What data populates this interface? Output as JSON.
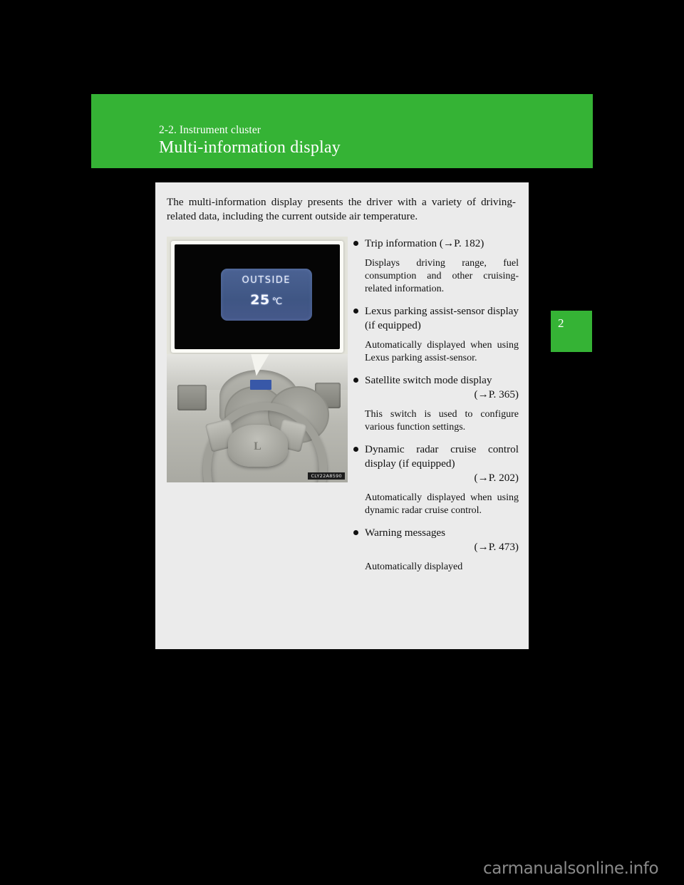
{
  "header": {
    "section": "2-2. Instrument cluster",
    "title": "Multi-information display"
  },
  "chapter_tab": {
    "number": "2"
  },
  "content": {
    "intro": "The multi-information display presents the driver with a variety of driving-related data, including the current outside air temperature."
  },
  "figure": {
    "meter_display": {
      "label": "OUTSIDE",
      "value": "25",
      "unit": "℃"
    },
    "wheel_logo": "L",
    "caption": "CLY22A8590"
  },
  "bullets": [
    {
      "head": "Trip information (→P. 182)",
      "ref": "",
      "body": "Displays driving range, fuel consumption and other cruising-related information."
    },
    {
      "head": "Lexus parking assist-sensor display (if equipped)",
      "ref": "",
      "body": "Automatically displayed when using Lexus parking assist-sensor."
    },
    {
      "head": "Satellite switch mode display",
      "ref": "(→P. 365)",
      "body": "This switch is used to configure various function settings."
    },
    {
      "head": "Dynamic radar cruise control display (if equipped)",
      "ref": "(→P. 202)",
      "body": "Automatically displayed when using dynamic radar cruise control."
    },
    {
      "head": "Warning messages",
      "ref": "(→P. 473)",
      "body": "Automatically displayed"
    }
  ],
  "watermark": {
    "text": "carmanualsonline.info"
  }
}
